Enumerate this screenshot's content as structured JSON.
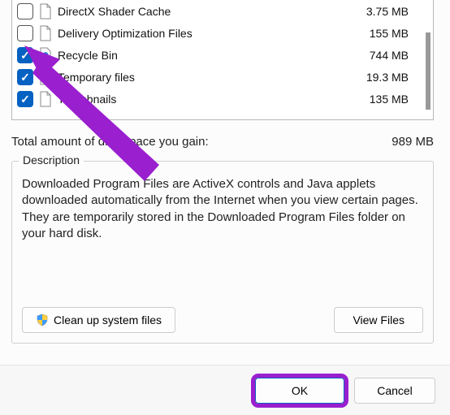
{
  "files": [
    {
      "label": "DirectX Shader Cache",
      "size": "3.75 MB",
      "checked": false,
      "icon": "page"
    },
    {
      "label": "Delivery Optimization Files",
      "size": "155 MB",
      "checked": false,
      "icon": "page"
    },
    {
      "label": "Recycle Bin",
      "size": "744 MB",
      "checked": true,
      "icon": "recycle"
    },
    {
      "label": "Temporary files",
      "size": "19.3 MB",
      "checked": true,
      "icon": "page"
    },
    {
      "label": "Thumbnails",
      "size": "135 MB",
      "checked": true,
      "icon": "page"
    }
  ],
  "total": {
    "label": "Total amount of disk space you gain:",
    "value": "989 MB"
  },
  "description": {
    "legend": "Description",
    "body": "Downloaded Program Files are ActiveX controls and Java applets downloaded automatically from the Internet when you view certain pages. They are temporarily stored in the Downloaded Program Files folder on your hard disk."
  },
  "buttons": {
    "cleanup": "Clean up system files",
    "view": "View Files",
    "ok": "OK",
    "cancel": "Cancel"
  }
}
